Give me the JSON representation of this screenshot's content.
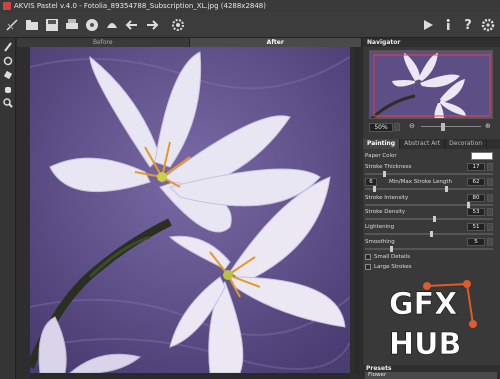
{
  "window": {
    "title": "AKVIS Pastel v.4.0 - Fotolia_89354788_Subscription_XL.jpg (4288x2848)"
  },
  "toolbar": {
    "icons": [
      "open-icon",
      "save-icon",
      "print-icon",
      "share-icon",
      "batch-icon",
      "undo-icon",
      "redo-icon",
      "settings-gear-icon",
      "run-icon",
      "info-icon",
      "help-icon",
      "preferences-icon"
    ]
  },
  "canvas": {
    "tab_before": "Before",
    "tab_after": "After"
  },
  "navigator": {
    "title": "Navigator",
    "zoom": "50%"
  },
  "settings": {
    "tabs": [
      "Painting",
      "Abstract Art",
      "Decoration"
    ],
    "paper_color_label": "Paper Color",
    "stroke_thickness": {
      "label": "Stroke Thickness",
      "value": "17"
    },
    "minmax": {
      "label": "Min/Max Stroke Length",
      "min": "6",
      "max": "62"
    },
    "stroke_intensity": {
      "label": "Stroke Intensity",
      "value": "80"
    },
    "stroke_density": {
      "label": "Stroke Density",
      "value": "53"
    },
    "lightening": {
      "label": "Lightening",
      "value": "51"
    },
    "smoothing": {
      "label": "Smoothing",
      "value": "5"
    },
    "small_details": "Small Details",
    "large_strokes": "Large Strokes"
  },
  "presets": {
    "title": "Presets",
    "selected": "Flower"
  },
  "watermark": {
    "line1": "GFX",
    "line2": "HUB"
  },
  "colors": {
    "paper": "#ffffff",
    "canvas_bg": "#5d4f86",
    "accent": "#e05a2a"
  }
}
